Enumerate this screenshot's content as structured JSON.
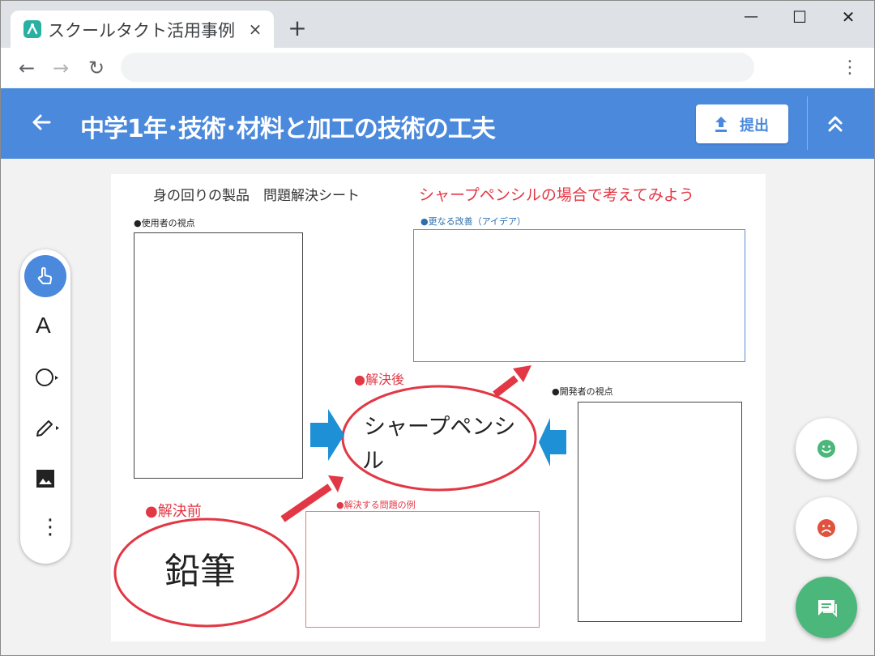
{
  "browser": {
    "tab_title": "スクールタクト活用事例",
    "tab_close": "×",
    "new_tab": "+",
    "window_controls": {
      "minimize": "—",
      "maximize": "☐",
      "close": "✕"
    },
    "nav": {
      "back": "←",
      "forward": "→",
      "reload": "↻",
      "menu": "⋮"
    },
    "address": ""
  },
  "header": {
    "title": "中学1年･技術･材料と加工の技術の工夫",
    "submit_label": "提出"
  },
  "worksheet": {
    "title": "身の回りの製品　問題解決シート",
    "subtitle": "シャープペンシルの場合で考えてみよう",
    "user_view": "●使用者の視点",
    "improvement": "●更なる改善（アイデア）",
    "developer_view": "●開発者の視点",
    "after": "●解決後",
    "before": "●解決前",
    "problems": "●解決する問題の例",
    "before_item": "鉛筆",
    "after_item_line1": "シャープペンシ",
    "after_item_line2": "ル"
  },
  "tools": {
    "text_tool": "A",
    "more": "⋮"
  },
  "colors": {
    "header": "#4a89dc",
    "accent_red": "#e23744",
    "arrow_blue": "#1e90d6",
    "fab_good": "#4bb77a",
    "fab_bad": "#e0523c"
  }
}
